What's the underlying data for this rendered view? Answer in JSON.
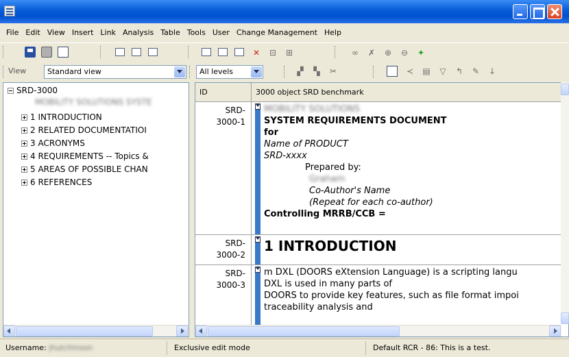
{
  "menu": [
    "File",
    "Edit",
    "View",
    "Insert",
    "Link",
    "Analysis",
    "Table",
    "Tools",
    "User",
    "Change Management",
    "Help"
  ],
  "toolbar": {
    "view_label": "View",
    "view_value": "Standard view",
    "level_value": "All levels"
  },
  "tree": {
    "root": "SRD-3000",
    "child_blurred": "MOBILITY SOLUTIONS SYSTE",
    "items": [
      "1 INTRODUCTION",
      "2 RELATED DOCUMENTATIOI",
      "3 ACRONYMS",
      "4 REQUIREMENTS -- Topics &",
      "5 AREAS OF POSSIBLE CHAN",
      "6 REFERENCES"
    ]
  },
  "grid": {
    "col_id": "ID",
    "col_title": "3000 object SRD benchmark",
    "rows": [
      {
        "id_line1": "SRD-",
        "id_line2": "3000-1",
        "blurred": "MOBILITY SOLUTIONS",
        "title": "SYSTEM REQUIREMENTS DOCUMENT",
        "for": "for",
        "product": "Name of PRODUCT",
        "srd": "SRD-xxxx",
        "prepared": "Prepared by:",
        "author_blurred": "Graham",
        "coauthor": "Co-Author's Name",
        "repeat": "(Repeat for each co-author)",
        "controlling": "Controlling MRRB/CCB ="
      },
      {
        "id_line1": "SRD-",
        "id_line2": "3000-2",
        "heading": "1 INTRODUCTION"
      },
      {
        "id_line1": "SRD-",
        "id_line2": "3000-3",
        "line1": "m  DXL (DOORS eXtension Language) is a scripting langu",
        "line2": "DXL is used in many parts of",
        "line3": "DOORS to provide key features, such as file format impoi",
        "line4": "traceability analysis and"
      }
    ]
  },
  "status": {
    "username_label": "Username:",
    "username_blurred": "jhutchinson",
    "mode": "Exclusive edit mode",
    "rcr": "Default RCR - 86: This is a test."
  }
}
